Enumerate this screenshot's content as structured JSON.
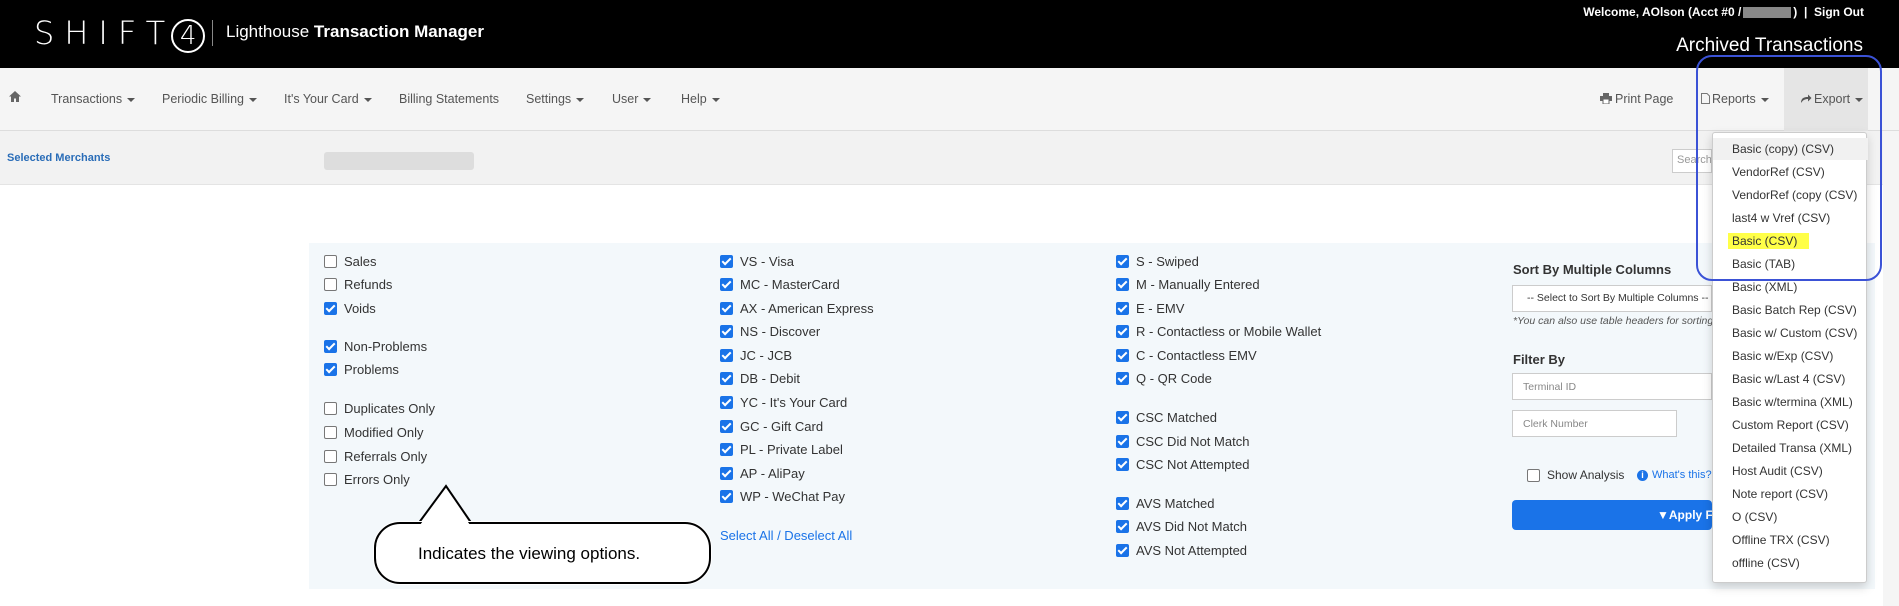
{
  "header": {
    "logo_text": "SHIFT",
    "logo_mark": "4",
    "app_name_regular": "Lighthouse",
    "app_name_bold": "Transaction Manager",
    "welcome_prefix": "Welcome, AOlson (Acct #0 /",
    "welcome_suffix": ")",
    "separator": "|",
    "sign_out": "Sign Out",
    "page_title": "Archived Transactions"
  },
  "nav": {
    "home_icon": "home-icon",
    "items": [
      "Transactions",
      "Periodic Billing",
      "It's Your Card",
      "Billing Statements",
      "Settings",
      "User",
      "Help"
    ],
    "print_page": "Print Page",
    "reports": "Reports",
    "export": "Export"
  },
  "merchant_bar": {
    "label": "Selected Merchants",
    "search_placeholder": "Search"
  },
  "filters": {
    "col1": [
      {
        "label": "Sales",
        "checked": false
      },
      {
        "label": "Refunds",
        "checked": false
      },
      {
        "label": "Voids",
        "checked": true
      },
      {
        "label": "Non-Problems",
        "checked": true
      },
      {
        "label": "Problems",
        "checked": true
      },
      {
        "label": "Duplicates Only",
        "checked": false
      },
      {
        "label": "Modified Only",
        "checked": false
      },
      {
        "label": "Referrals Only",
        "checked": false
      },
      {
        "label": "Errors Only",
        "checked": false
      }
    ],
    "col2": [
      {
        "label": "VS - Visa",
        "checked": true
      },
      {
        "label": "MC - MasterCard",
        "checked": true
      },
      {
        "label": "AX - American Express",
        "checked": true
      },
      {
        "label": "NS - Discover",
        "checked": true
      },
      {
        "label": "JC - JCB",
        "checked": true
      },
      {
        "label": "DB - Debit",
        "checked": true
      },
      {
        "label": "YC - It's Your Card",
        "checked": true
      },
      {
        "label": "GC - Gift Card",
        "checked": true
      },
      {
        "label": "PL - Private Label",
        "checked": true
      },
      {
        "label": "AP - AliPay",
        "checked": true
      },
      {
        "label": "WP - WeChat Pay",
        "checked": true
      }
    ],
    "select_all": "Select All / Deselect All",
    "col3": [
      {
        "label": "S - Swiped",
        "checked": true
      },
      {
        "label": "M - Manually Entered",
        "checked": true
      },
      {
        "label": "E - EMV",
        "checked": true
      },
      {
        "label": "R - Contactless or Mobile Wallet",
        "checked": true
      },
      {
        "label": "C - Contactless EMV",
        "checked": true
      },
      {
        "label": "Q - QR Code",
        "checked": true
      },
      {
        "label": "CSC Matched",
        "checked": true
      },
      {
        "label": "CSC Did Not Match",
        "checked": true
      },
      {
        "label": "CSC Not Attempted",
        "checked": true
      },
      {
        "label": "AVS Matched",
        "checked": true
      },
      {
        "label": "AVS Did Not Match",
        "checked": true
      },
      {
        "label": "AVS Not Attempted",
        "checked": true
      }
    ]
  },
  "sort": {
    "heading": "Sort By Multiple Columns",
    "select_value": "-- Select to Sort By Multiple Columns --",
    "note": "*You can also use table headers for sorting"
  },
  "filter_by": {
    "heading": "Filter By",
    "terminal_placeholder": "Terminal ID",
    "clerk_placeholder": "Clerk Number",
    "show_analysis": "Show Analysis",
    "whats_this": "What's this?",
    "apply_button": "Apply Filters"
  },
  "export_menu": [
    "Basic (copy) (CSV)",
    "VendorRef (CSV)",
    "VendorRef (copy (CSV)",
    "last4 w Vref (CSV)",
    "Basic (CSV)",
    "Basic (TAB)",
    "Basic (XML)",
    "Basic Batch Rep (CSV)",
    "Basic w/ Custom (CSV)",
    "Basic w/Exp (CSV)",
    "Basic w/Last 4 (CSV)",
    "Basic w/termina (XML)",
    "Custom Report (CSV)",
    "Detailed Transa (XML)",
    "Host Audit (CSV)",
    "Note report (CSV)",
    "O (CSV)",
    "Offline TRX (CSV)",
    "offline (CSV)"
  ],
  "annotation": {
    "callout": "Indicates the viewing options.",
    "highlight_color": "#3b52d6",
    "marker_color": "#ffff48"
  }
}
